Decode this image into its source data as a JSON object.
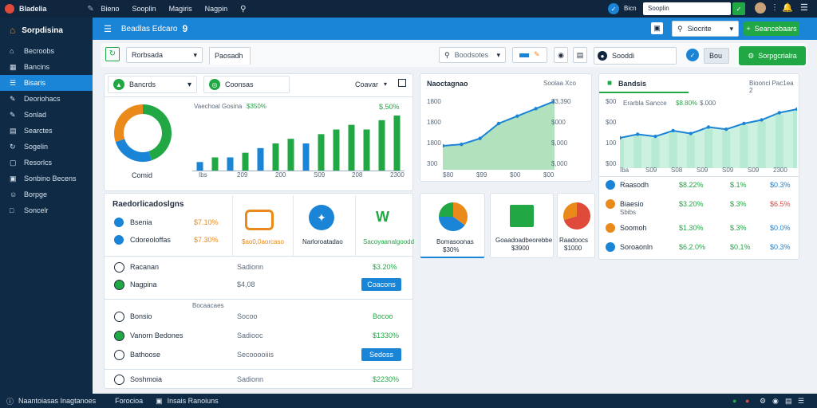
{
  "topbar": {
    "app_name": "Bladelia",
    "menu": [
      "Bieno",
      "Sooplin",
      "Magiris",
      "Nagpin"
    ],
    "search_value": "Sooplin",
    "dot_label": "Bicn"
  },
  "sidebar": {
    "title": "Sorpdisina",
    "items": [
      {
        "label": "Becroobs",
        "icon": "home-icon"
      },
      {
        "label": "Bancins",
        "icon": "grid-icon"
      },
      {
        "label": "Bisaris",
        "icon": "list-icon"
      },
      {
        "label": "Deoriohacs",
        "icon": "pen-icon"
      },
      {
        "label": "Sonlad",
        "icon": "pen-icon"
      },
      {
        "label": "Searctes",
        "icon": "chart-icon"
      },
      {
        "label": "Sogelin",
        "icon": "refresh-icon"
      },
      {
        "label": "Resorlcs",
        "icon": "folder-icon"
      },
      {
        "label": "Sonbino Becens",
        "icon": "doc-icon"
      },
      {
        "label": "Borpge",
        "icon": "user-icon"
      },
      {
        "label": "Soncelr",
        "icon": "square-icon"
      }
    ]
  },
  "header": {
    "title": "Beadlas Edcaro",
    "badge": "9",
    "select_label": "Siocrite",
    "button_label": "Seancebaars"
  },
  "toolbar": {
    "select_label": "Rorbsada",
    "tab_label": "Paosadh",
    "search_placeholder": "Boodsotes",
    "search_right": "Sooddi",
    "compact_label": "Bou",
    "green_button": "Sorpgcrialra"
  },
  "panel_a": {
    "tab1": "Bancrds",
    "tab2": "Coonsas",
    "right_label": "Coavar",
    "donut_label": "Comid",
    "bar_title": "Vaechoal Gosina",
    "bar_value": "$350%",
    "bar_value2": "$.50%",
    "x_ticks": [
      "Ibs",
      "209",
      "200",
      "S09",
      "208",
      "2300"
    ]
  },
  "panel_b": {
    "title": "Naoctagnao",
    "right": "Soolaa Xco",
    "left_ticks": [
      "1800",
      "1800",
      "1800",
      "300"
    ],
    "right_ticks": [
      "$3,390",
      "$000",
      "$,000",
      "$,000"
    ],
    "x_ticks": [
      "$80",
      "$99",
      "$00",
      "$00"
    ]
  },
  "panel_c": {
    "title": "Bandsis",
    "right": "Bioonci Pac1ea 2",
    "left_ticks": [
      "$00",
      "$00",
      "100",
      "$00"
    ],
    "legend": [
      "Erarbla Sancce",
      "$8.80%",
      "$.000"
    ],
    "x_ticks": [
      "Iba",
      "S09",
      "S08",
      "S09",
      "S09",
      "S09",
      "2300"
    ],
    "rows": [
      {
        "label": "Raasodh",
        "v1": "$8.22%",
        "v2": "$.1%",
        "v3": "$0.3%"
      },
      {
        "label": "Biaesio",
        "sub": "Sbibs",
        "v1": "$3.20%",
        "v2": "$.3%",
        "v3": "$6.5%"
      },
      {
        "label": "Soomoh",
        "v1": "$1.30%",
        "v2": "$.3%",
        "v3": "$0.0%"
      },
      {
        "label": "Soroaonln",
        "v1": "$6.2.0%",
        "v2": "$0.1%",
        "v3": "$0.3%"
      }
    ]
  },
  "panel_d": {
    "title": "Raedorlicadoslgns",
    "rows": [
      {
        "label": "Bsenia",
        "val": "$7.10%"
      },
      {
        "label": "Cdoreoloffas",
        "val": "$7.30%"
      }
    ],
    "tiles": [
      {
        "label": "$ao0,0aorcaso"
      },
      {
        "label": "Narloroatadao"
      },
      {
        "label": "Sacoyaanalgoodd"
      }
    ],
    "list": [
      {
        "label": "Racanan",
        "mid": "Sadionn",
        "val": "$3.20%"
      },
      {
        "label": "Nagpina",
        "mid": "$4,08",
        "btn": "Coacons"
      }
    ],
    "center_label": "Bocaacaes",
    "list2": [
      {
        "label": "Bonsio",
        "mid": "Socoo",
        "val": "Bocoo"
      },
      {
        "label": "Vanorn Bedones",
        "mid": "Sadiooc",
        "val": "$1330%"
      },
      {
        "label": "Bathoose",
        "mid": "Secooooiiis",
        "btn": "Sedoss"
      }
    ],
    "last": {
      "label": "Soshmoia",
      "mid": "Sadionn",
      "val": "$2230%"
    }
  },
  "tiles_row": [
    {
      "label": "Bomasoonas",
      "val": "$30%"
    },
    {
      "label": "Goaadoadbeorebbe",
      "val": "$3900"
    },
    {
      "label": "Raadoocs",
      "val": "$1000"
    }
  ],
  "footer": {
    "left": "Naantoiasas Inagtanoes",
    "mid1": "Forocioa",
    "mid2": "Insais Ranoiuns"
  },
  "colors": {
    "primary": "#1a84d6",
    "green": "#21a845",
    "orange": "#e98a1b",
    "dark": "#0f2a44"
  },
  "chart_data": [
    {
      "type": "pie",
      "title": "",
      "values": [
        45,
        25,
        30
      ],
      "colors": [
        "#21a845",
        "#1a84d6",
        "#e98a1b"
      ]
    },
    {
      "type": "bar",
      "title": "Vaechoal Gosina",
      "values": [
        2,
        3,
        3,
        4,
        5,
        6,
        7,
        6,
        8,
        9,
        10,
        9,
        11,
        12
      ]
    },
    {
      "type": "area",
      "title": "Naoctagnao",
      "values": [
        3,
        3.2,
        4,
        6,
        7,
        8,
        9
      ]
    },
    {
      "type": "area",
      "title": "Bandsis",
      "values": [
        4,
        4.5,
        4.2,
        5,
        4.6,
        5.5,
        5.2,
        6,
        6.5,
        7.5,
        8
      ]
    },
    {
      "type": "pie",
      "title": "",
      "values": [
        35,
        40,
        25
      ],
      "colors": [
        "#e98a1b",
        "#1a84d6",
        "#21a845"
      ]
    },
    {
      "type": "pie",
      "title": "",
      "values": [
        70,
        30
      ],
      "colors": [
        "#e04a3a",
        "#e98a1b"
      ]
    }
  ]
}
